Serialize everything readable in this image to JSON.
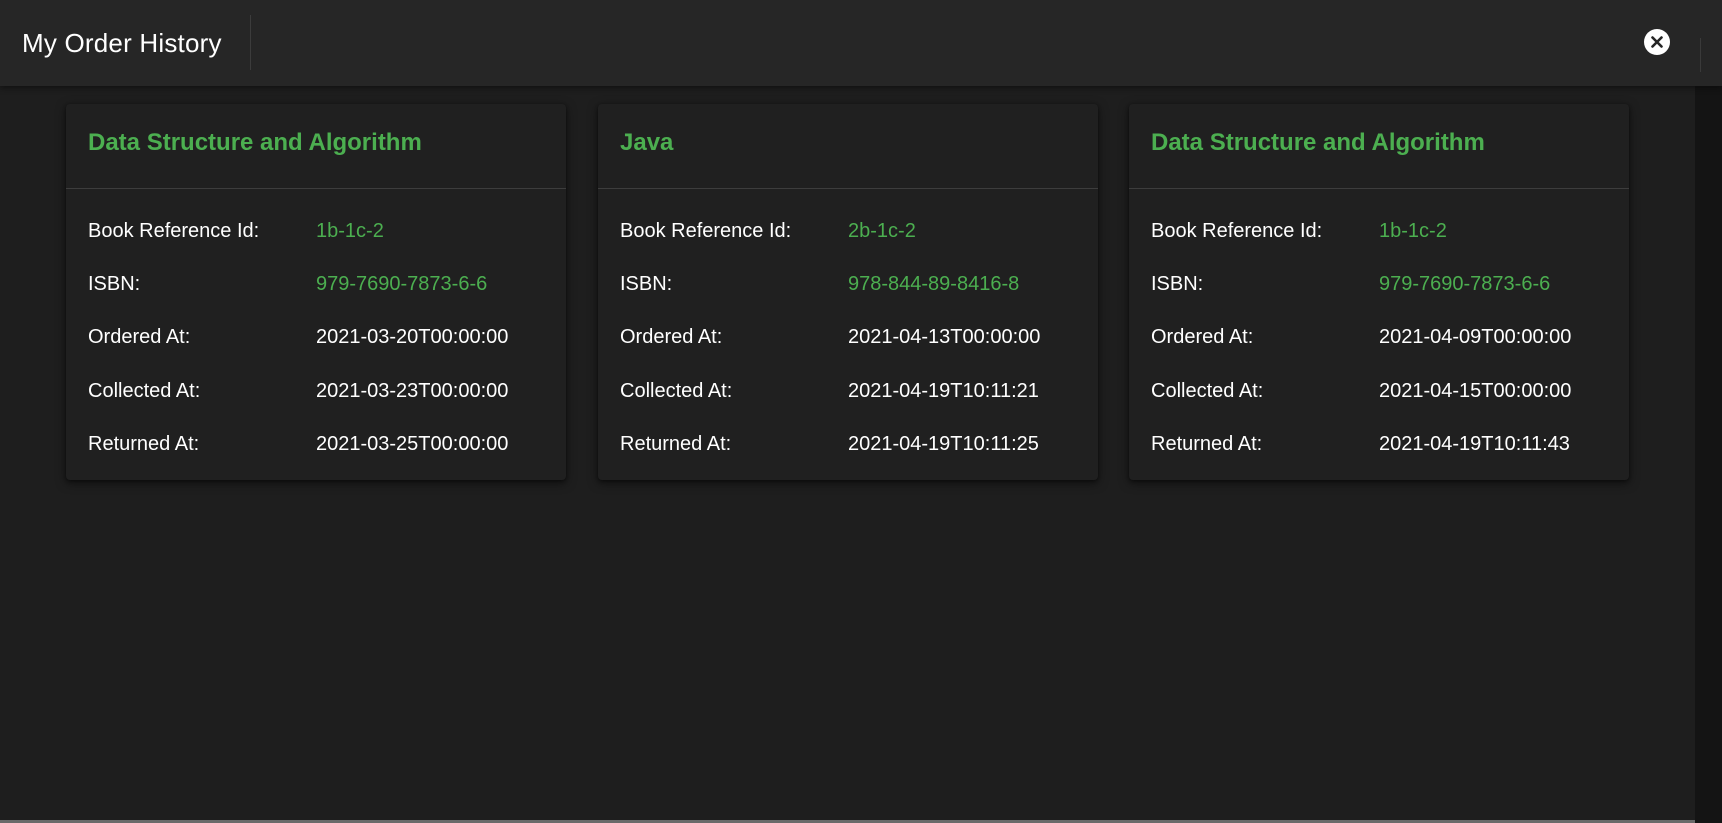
{
  "dialog": {
    "title": "My Order History",
    "close_icon": "close-circle-icon"
  },
  "labels": {
    "book_reference_id": "Book Reference Id:",
    "isbn": "ISBN:",
    "ordered_at": "Ordered At:",
    "collected_at": "Collected At:",
    "returned_at": "Returned At:"
  },
  "colors": {
    "accent": "#4caf50",
    "background": "#1e1e1e",
    "card": "#202020",
    "header": "#262626"
  },
  "orders": [
    {
      "title": "Data Structure and Algorithm",
      "book_reference_id": "1b-1c-2",
      "isbn": "979-7690-7873-6-6",
      "ordered_at": "2021-03-20T00:00:00",
      "collected_at": "2021-03-23T00:00:00",
      "returned_at": "2021-03-25T00:00:00"
    },
    {
      "title": "Java",
      "book_reference_id": "2b-1c-2",
      "isbn": "978-844-89-8416-8",
      "ordered_at": "2021-04-13T00:00:00",
      "collected_at": "2021-04-19T10:11:21",
      "returned_at": "2021-04-19T10:11:25"
    },
    {
      "title": "Data Structure and Algorithm",
      "book_reference_id": "1b-1c-2",
      "isbn": "979-7690-7873-6-6",
      "ordered_at": "2021-04-09T00:00:00",
      "collected_at": "2021-04-15T00:00:00",
      "returned_at": "2021-04-19T10:11:43"
    }
  ]
}
